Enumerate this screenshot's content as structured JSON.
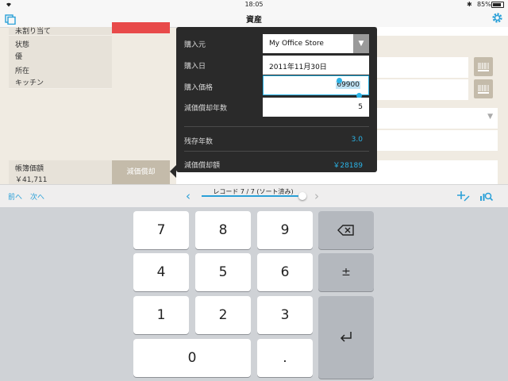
{
  "status": {
    "time": "18:05",
    "battery": "85%"
  },
  "nav": {
    "title": "資産"
  },
  "left": {
    "truncated_label": "未割り当て",
    "state_label": "状態",
    "state_value": "優",
    "location_label": "所在",
    "location_value": "キッチン",
    "book_value_label": "帳簿価額",
    "book_value": "￥41,711",
    "depreciation_button": "減価償却"
  },
  "popover": {
    "vendor_label": "購入元",
    "vendor_value": "My Office Store",
    "date_label": "購入日",
    "date_value": "2011年11月30日",
    "price_label": "購入価格",
    "price_value": "69900",
    "years_label": "減価償却年数",
    "years_value": "5",
    "remaining_label": "残存年数",
    "remaining_value": "3.0",
    "amount_label": "減価償却額",
    "amount_value": "￥28189"
  },
  "toolbar": {
    "prev": "前へ",
    "next": "次へ",
    "record": "レコード 7 / 7 (ソート済み)",
    "record_fraction": 1.0
  },
  "keypad": {
    "k7": "7",
    "k8": "8",
    "k9": "9",
    "k4": "4",
    "k5": "5",
    "k6": "6",
    "k1": "1",
    "k2": "2",
    "k3": "3",
    "k0": "0",
    "dot": ".",
    "plusminus": "±"
  },
  "colors": {
    "accent": "#2ab3e6",
    "popover_bg": "#2a2a2a",
    "red": "#e84a4a"
  }
}
